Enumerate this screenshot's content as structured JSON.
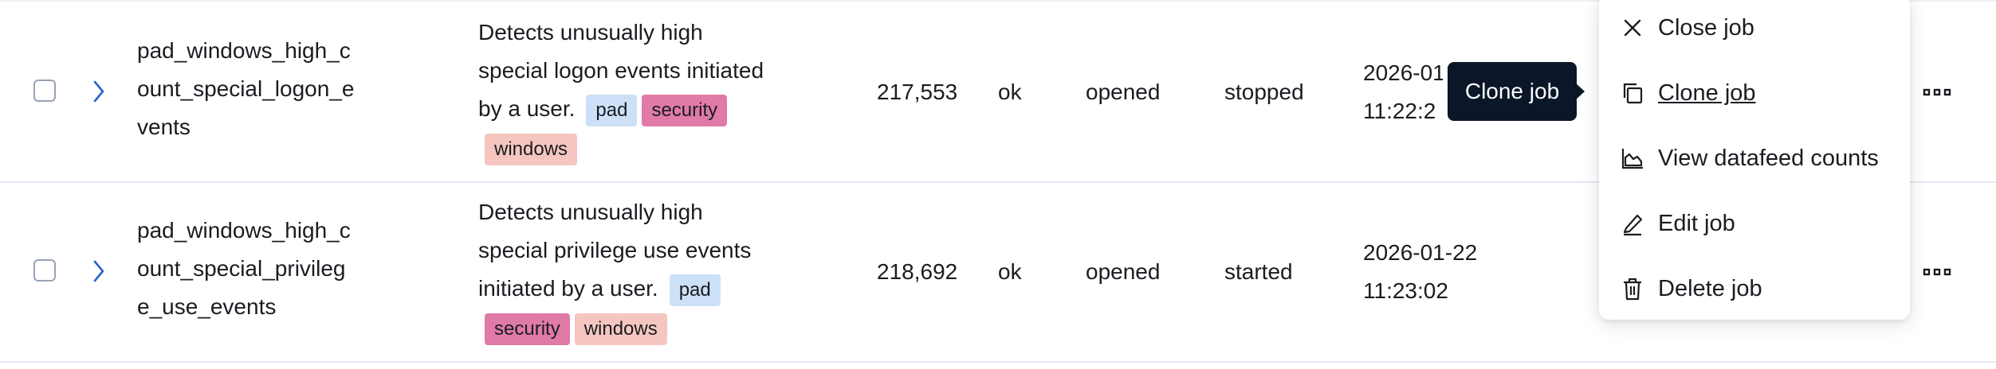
{
  "rows": [
    {
      "job_id_lines": [
        "pad_windows_high_c",
        "ount_special_logon_e",
        "vents"
      ],
      "description_lines": [
        "Detects unusually high",
        "special logon events initiated",
        "by a user."
      ],
      "badges": [
        "pad",
        "security",
        "windows"
      ],
      "processed_records": "217,553",
      "memory_status": "ok",
      "job_state": "opened",
      "datafeed_state": "stopped",
      "latest_timestamp_lines": [
        "2026-01-22",
        "11:22:2"
      ]
    },
    {
      "job_id_lines": [
        "pad_windows_high_c",
        "ount_special_privileg",
        "e_use_events"
      ],
      "description_lines": [
        "Detects unusually high",
        "special privilege use events",
        "initiated by a user."
      ],
      "badges": [
        "pad",
        "security",
        "windows"
      ],
      "processed_records": "218,692",
      "memory_status": "ok",
      "job_state": "opened",
      "datafeed_state": "started",
      "latest_timestamp_lines": [
        "2026-01-22",
        "11:23:02"
      ]
    }
  ],
  "actions_menu": {
    "items": [
      {
        "label": "Close job",
        "icon": "close-icon"
      },
      {
        "label": "Clone job",
        "icon": "copy-icon"
      },
      {
        "label": "View datafeed counts",
        "icon": "area-chart-icon"
      },
      {
        "label": "Edit job",
        "icon": "pencil-icon"
      },
      {
        "label": "Delete job",
        "icon": "trash-icon"
      }
    ],
    "hovered_item": "Clone job"
  },
  "tooltip": {
    "text": "Clone job"
  },
  "colors": {
    "badge_pad": "#cce0f7",
    "badge_security": "#e07aa7",
    "badge_windows": "#f5c6c0",
    "link": "#2a62c9",
    "tooltip_bg": "#0b1628"
  }
}
